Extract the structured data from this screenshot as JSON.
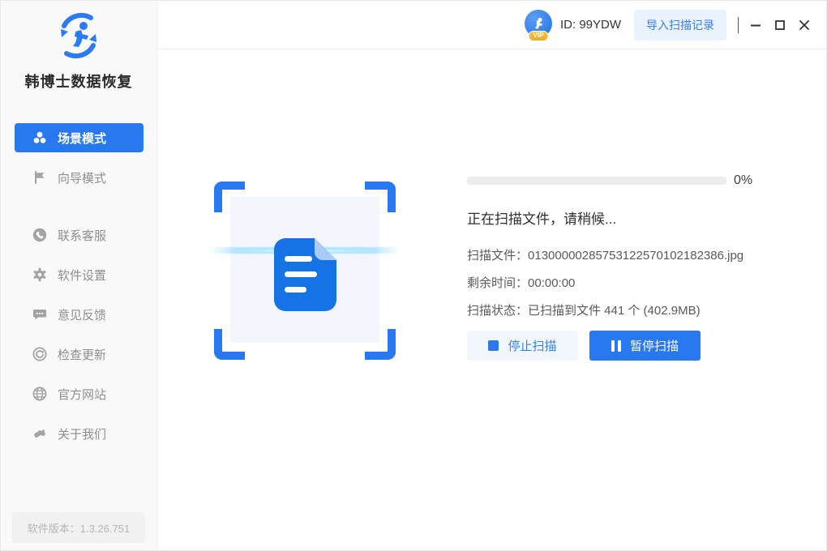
{
  "app": {
    "name": "韩博士数据恢复",
    "version": "软件版本：1.3.26.751"
  },
  "topbar": {
    "id_text": "ID: 99YDW",
    "vip_badge": "VIP",
    "import_button": "导入扫描记录"
  },
  "sidebar": {
    "items": [
      {
        "label": "场景模式",
        "icon": "scene-mode-icon",
        "active": true
      },
      {
        "label": "向导模式",
        "icon": "flag-icon",
        "active": false
      },
      {
        "label": "联系客服",
        "icon": "phone-icon",
        "active": false
      },
      {
        "label": "软件设置",
        "icon": "gear-icon",
        "active": false
      },
      {
        "label": "意见反馈",
        "icon": "feedback-icon",
        "active": false
      },
      {
        "label": "检查更新",
        "icon": "update-icon",
        "active": false
      },
      {
        "label": "官方网站",
        "icon": "globe-icon",
        "active": false
      },
      {
        "label": "关于我们",
        "icon": "handshake-icon",
        "active": false
      }
    ]
  },
  "scan": {
    "progress_value": 0,
    "progress_label": "0%",
    "message": "正在扫描文件，请稍候...",
    "rows": [
      {
        "label": "扫描文件：",
        "value": "01300000285753122570102182386.jpg"
      },
      {
        "label": "剩余时间：",
        "value": "00:00:00"
      },
      {
        "label": "扫描状态：",
        "value": "已扫描到文件 441 个 (402.9MB)"
      }
    ],
    "stop_button": "停止扫描",
    "pause_button": "暂停扫描"
  },
  "colors": {
    "accent": "#2878f0",
    "accent_light_bg": "#eaf2fd",
    "doc_blue": "#1673e6",
    "scanline": "#7fd4ff",
    "vip_gold": "#f2b136"
  }
}
